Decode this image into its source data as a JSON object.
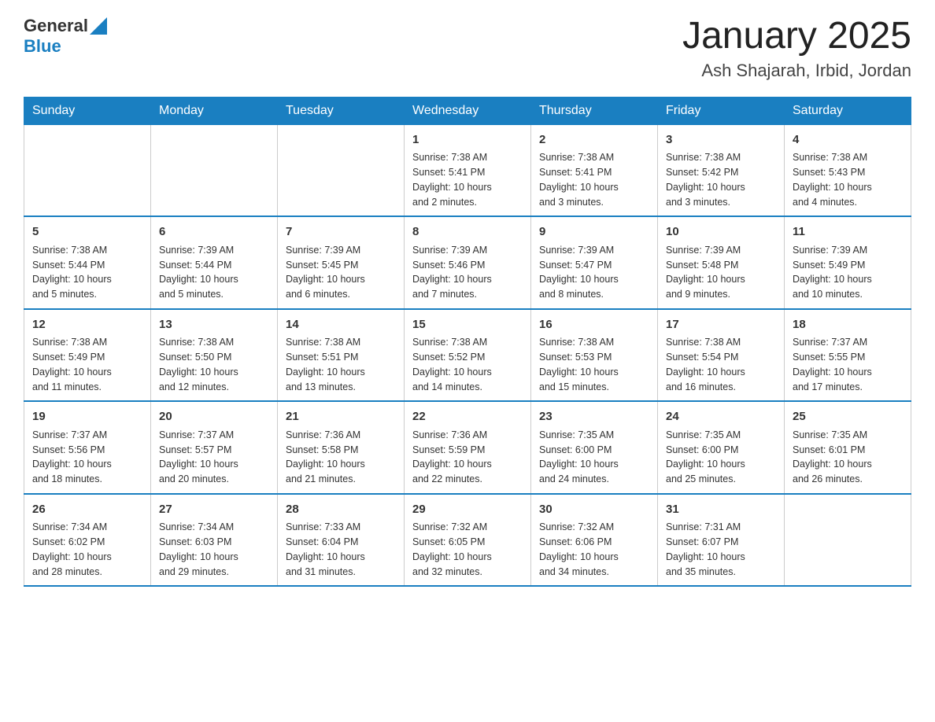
{
  "header": {
    "logo_general": "General",
    "logo_blue": "Blue",
    "title": "January 2025",
    "subtitle": "Ash Shajarah, Irbid, Jordan"
  },
  "weekdays": [
    "Sunday",
    "Monday",
    "Tuesday",
    "Wednesday",
    "Thursday",
    "Friday",
    "Saturday"
  ],
  "weeks": [
    [
      {
        "day": "",
        "info": ""
      },
      {
        "day": "",
        "info": ""
      },
      {
        "day": "",
        "info": ""
      },
      {
        "day": "1",
        "info": "Sunrise: 7:38 AM\nSunset: 5:41 PM\nDaylight: 10 hours\nand 2 minutes."
      },
      {
        "day": "2",
        "info": "Sunrise: 7:38 AM\nSunset: 5:41 PM\nDaylight: 10 hours\nand 3 minutes."
      },
      {
        "day": "3",
        "info": "Sunrise: 7:38 AM\nSunset: 5:42 PM\nDaylight: 10 hours\nand 3 minutes."
      },
      {
        "day": "4",
        "info": "Sunrise: 7:38 AM\nSunset: 5:43 PM\nDaylight: 10 hours\nand 4 minutes."
      }
    ],
    [
      {
        "day": "5",
        "info": "Sunrise: 7:38 AM\nSunset: 5:44 PM\nDaylight: 10 hours\nand 5 minutes."
      },
      {
        "day": "6",
        "info": "Sunrise: 7:39 AM\nSunset: 5:44 PM\nDaylight: 10 hours\nand 5 minutes."
      },
      {
        "day": "7",
        "info": "Sunrise: 7:39 AM\nSunset: 5:45 PM\nDaylight: 10 hours\nand 6 minutes."
      },
      {
        "day": "8",
        "info": "Sunrise: 7:39 AM\nSunset: 5:46 PM\nDaylight: 10 hours\nand 7 minutes."
      },
      {
        "day": "9",
        "info": "Sunrise: 7:39 AM\nSunset: 5:47 PM\nDaylight: 10 hours\nand 8 minutes."
      },
      {
        "day": "10",
        "info": "Sunrise: 7:39 AM\nSunset: 5:48 PM\nDaylight: 10 hours\nand 9 minutes."
      },
      {
        "day": "11",
        "info": "Sunrise: 7:39 AM\nSunset: 5:49 PM\nDaylight: 10 hours\nand 10 minutes."
      }
    ],
    [
      {
        "day": "12",
        "info": "Sunrise: 7:38 AM\nSunset: 5:49 PM\nDaylight: 10 hours\nand 11 minutes."
      },
      {
        "day": "13",
        "info": "Sunrise: 7:38 AM\nSunset: 5:50 PM\nDaylight: 10 hours\nand 12 minutes."
      },
      {
        "day": "14",
        "info": "Sunrise: 7:38 AM\nSunset: 5:51 PM\nDaylight: 10 hours\nand 13 minutes."
      },
      {
        "day": "15",
        "info": "Sunrise: 7:38 AM\nSunset: 5:52 PM\nDaylight: 10 hours\nand 14 minutes."
      },
      {
        "day": "16",
        "info": "Sunrise: 7:38 AM\nSunset: 5:53 PM\nDaylight: 10 hours\nand 15 minutes."
      },
      {
        "day": "17",
        "info": "Sunrise: 7:38 AM\nSunset: 5:54 PM\nDaylight: 10 hours\nand 16 minutes."
      },
      {
        "day": "18",
        "info": "Sunrise: 7:37 AM\nSunset: 5:55 PM\nDaylight: 10 hours\nand 17 minutes."
      }
    ],
    [
      {
        "day": "19",
        "info": "Sunrise: 7:37 AM\nSunset: 5:56 PM\nDaylight: 10 hours\nand 18 minutes."
      },
      {
        "day": "20",
        "info": "Sunrise: 7:37 AM\nSunset: 5:57 PM\nDaylight: 10 hours\nand 20 minutes."
      },
      {
        "day": "21",
        "info": "Sunrise: 7:36 AM\nSunset: 5:58 PM\nDaylight: 10 hours\nand 21 minutes."
      },
      {
        "day": "22",
        "info": "Sunrise: 7:36 AM\nSunset: 5:59 PM\nDaylight: 10 hours\nand 22 minutes."
      },
      {
        "day": "23",
        "info": "Sunrise: 7:35 AM\nSunset: 6:00 PM\nDaylight: 10 hours\nand 24 minutes."
      },
      {
        "day": "24",
        "info": "Sunrise: 7:35 AM\nSunset: 6:00 PM\nDaylight: 10 hours\nand 25 minutes."
      },
      {
        "day": "25",
        "info": "Sunrise: 7:35 AM\nSunset: 6:01 PM\nDaylight: 10 hours\nand 26 minutes."
      }
    ],
    [
      {
        "day": "26",
        "info": "Sunrise: 7:34 AM\nSunset: 6:02 PM\nDaylight: 10 hours\nand 28 minutes."
      },
      {
        "day": "27",
        "info": "Sunrise: 7:34 AM\nSunset: 6:03 PM\nDaylight: 10 hours\nand 29 minutes."
      },
      {
        "day": "28",
        "info": "Sunrise: 7:33 AM\nSunset: 6:04 PM\nDaylight: 10 hours\nand 31 minutes."
      },
      {
        "day": "29",
        "info": "Sunrise: 7:32 AM\nSunset: 6:05 PM\nDaylight: 10 hours\nand 32 minutes."
      },
      {
        "day": "30",
        "info": "Sunrise: 7:32 AM\nSunset: 6:06 PM\nDaylight: 10 hours\nand 34 minutes."
      },
      {
        "day": "31",
        "info": "Sunrise: 7:31 AM\nSunset: 6:07 PM\nDaylight: 10 hours\nand 35 minutes."
      },
      {
        "day": "",
        "info": ""
      }
    ]
  ]
}
